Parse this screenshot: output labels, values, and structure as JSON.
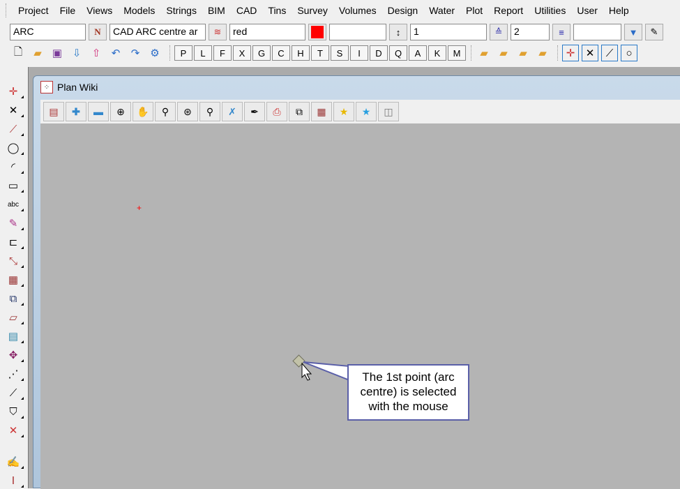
{
  "menu": [
    "Project",
    "File",
    "Views",
    "Models",
    "Strings",
    "BIM",
    "CAD",
    "Tins",
    "Survey",
    "Volumes",
    "Design",
    "Water",
    "Plot",
    "Report",
    "Utilities",
    "User",
    "Help"
  ],
  "toolbar": {
    "name_field": "ARC",
    "style_field": "CAD ARC centre ar",
    "colour_field": "red",
    "colour_swatch": "#ff0000",
    "blank_field": "",
    "weight_field": "1",
    "linestyle_field": "2",
    "extra_field": ""
  },
  "letters": [
    "P",
    "L",
    "F",
    "X",
    "G",
    "C",
    "H",
    "T",
    "S",
    "I",
    "D",
    "Q",
    "A",
    "K",
    "M"
  ],
  "window": {
    "title": "Plan Wiki"
  },
  "canvas": {
    "background": "#b4b4b4",
    "marker_color": "#ff0000"
  },
  "callout": {
    "lines": [
      "The 1st point (arc",
      "centre) is selected",
      "with the mouse"
    ]
  }
}
